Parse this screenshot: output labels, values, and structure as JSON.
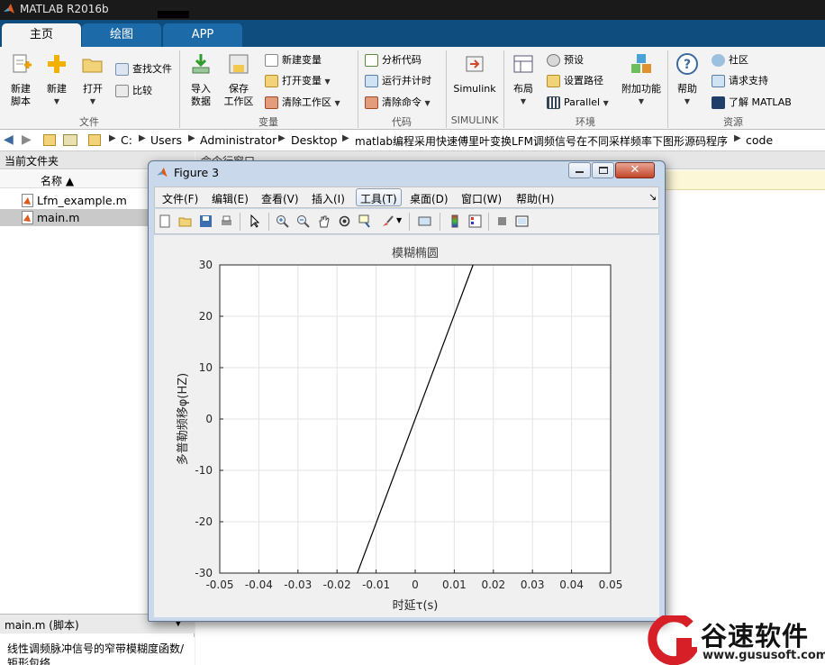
{
  "app": {
    "title": "MATLAB R2016b"
  },
  "ribbon_tabs": [
    {
      "label": "主页"
    },
    {
      "label": "绘图"
    },
    {
      "label": "APP"
    }
  ],
  "ribbon": {
    "groups": [
      "文件",
      "变量",
      "代码",
      "SIMULINK",
      "环境",
      "资源"
    ],
    "new_script": "新建\n脚本",
    "new": "新建",
    "open": "打开",
    "find_files": "查找文件",
    "compare": "比较",
    "import_data": "导入\n数据",
    "save_workspace": "保存\n工作区",
    "new_variable": "新建变量",
    "open_variable": "打开变量",
    "clear_workspace": "清除工作区",
    "analyze_code": "分析代码",
    "run_and_time": "运行并计时",
    "clear_commands": "清除命令",
    "simulink": "Simulink",
    "layout": "布局",
    "preferences": "预设",
    "set_path": "设置路径",
    "parallel": "Parallel",
    "addons": "附加功能",
    "help": "帮助",
    "community": "社区",
    "request_support": "请求支持",
    "learn_matlab": "了解 MATLAB"
  },
  "address": {
    "crumbs": [
      "C:",
      "Users",
      "Administrator",
      "Desktop",
      "matlab编程采用快速傅里叶变换LFM调频信号在不同采样频率下图形源码程序",
      "code"
    ]
  },
  "file_panel": {
    "title": "当前文件夹",
    "col_name": "名称 ▲",
    "files": [
      {
        "name": "Lfm_example.m"
      },
      {
        "name": "main.m"
      }
    ],
    "detail_title": "main.m  (脚本)",
    "detail_text": "线性调频脉冲信号的窄带模糊度函数/矩形包络"
  },
  "command_window": {
    "title": "命令行窗口"
  },
  "figure": {
    "title": "Figure 3",
    "menus": [
      "文件(F)",
      "编辑(E)",
      "查看(V)",
      "插入(I)",
      "工具(T)",
      "桌面(D)",
      "窗口(W)",
      "帮助(H)"
    ]
  },
  "chart_data": {
    "type": "line",
    "title": "模糊椭圆",
    "xlabel": "时延τ(s)",
    "ylabel": "多普勒频移φ(HZ)",
    "xlim": [
      -0.05,
      0.05
    ],
    "ylim": [
      -30,
      30
    ],
    "xticks": [
      "-0.05",
      "-0.04",
      "-0.03",
      "-0.02",
      "-0.01",
      "0",
      "0.01",
      "0.02",
      "0.03",
      "0.04",
      "0.05"
    ],
    "yticks": [
      "30",
      "20",
      "10",
      "0",
      "-10",
      "-20",
      "-30"
    ],
    "grid": true,
    "series": [
      {
        "x": [
          -0.0148,
          0.0148
        ],
        "y": [
          -30,
          30
        ],
        "color": "#000000"
      }
    ]
  },
  "watermark": {
    "brand": "谷速软件",
    "url": "www.gususoft.com"
  },
  "colors": {
    "ribbon_bg": "#0f4d7e",
    "tab_active": "#f3f3f3",
    "figure_frame": "#c9d8ea",
    "plot_line": "#000000"
  }
}
